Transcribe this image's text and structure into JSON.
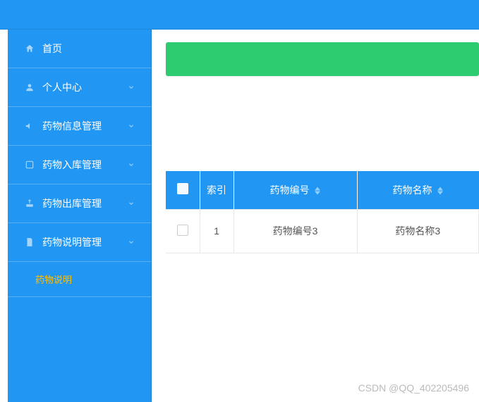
{
  "sidebar": {
    "items": [
      {
        "label": "首页",
        "icon": "home-icon",
        "has_children": false
      },
      {
        "label": "个人中心",
        "icon": "user-icon",
        "has_children": true
      },
      {
        "label": "药物信息管理",
        "icon": "megaphone-icon",
        "has_children": true
      },
      {
        "label": "药物入库管理",
        "icon": "inbox-icon",
        "has_children": true
      },
      {
        "label": "药物出库管理",
        "icon": "outbox-icon",
        "has_children": true
      },
      {
        "label": "药物说明管理",
        "icon": "doc-icon",
        "has_children": true
      }
    ],
    "submenu": {
      "label": "药物说明"
    }
  },
  "table": {
    "headers": {
      "index": "索引",
      "code": "药物编号",
      "name": "药物名称"
    },
    "rows": [
      {
        "index": "1",
        "code": "药物编号3",
        "name": "药物名称3"
      }
    ]
  },
  "watermark": "CSDN @QQ_402205496",
  "colors": {
    "primary": "#2196F3",
    "accent": "#2ECC71",
    "highlight": "#FFC107"
  },
  "chart_data": {
    "type": "table",
    "title": "",
    "columns": [
      "索引",
      "药物编号",
      "药物名称"
    ],
    "rows": [
      [
        "1",
        "药物编号3",
        "药物名称3"
      ]
    ]
  }
}
